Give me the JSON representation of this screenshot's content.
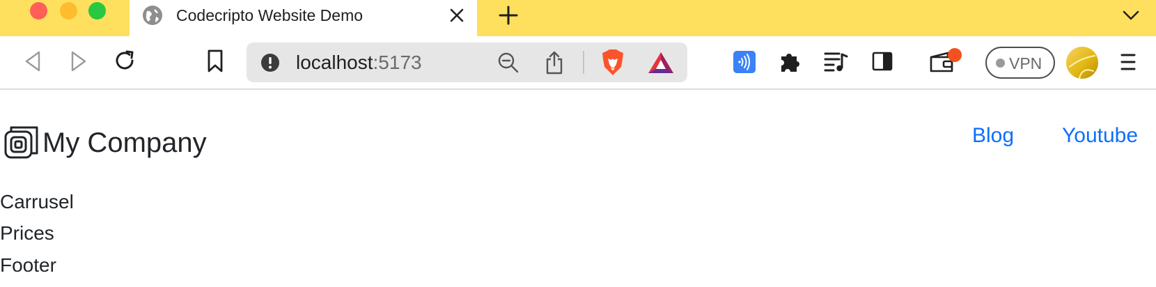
{
  "browser": {
    "tab": {
      "title": "Codecripto Website Demo"
    },
    "address": {
      "host": "localhost",
      "port": ":5173"
    },
    "vpn_label": "VPN",
    "wallet_badge_color": "#f4511e",
    "tabstrip_color": "#ffdf5e"
  },
  "page": {
    "brand": "My Company",
    "nav": {
      "blog": "Blog",
      "youtube": "Youtube"
    },
    "sections": [
      "Carrusel",
      "Prices",
      "Footer"
    ],
    "link_color": "#0d6efd"
  },
  "icons": {
    "tabstrip": [
      "globe-icon",
      "close-icon",
      "plus-icon",
      "chevron-down-icon"
    ],
    "toolbar": [
      "back-icon",
      "forward-icon",
      "reload-icon",
      "bookmark-icon",
      "info-icon",
      "zoom-out-icon",
      "share-icon",
      "brave-lion-icon",
      "brave-rewards-icon",
      "speedreader-icon",
      "puzzle-icon",
      "playlist-icon",
      "sidebar-icon",
      "wallet-icon",
      "avatar-icon",
      "menu-icon"
    ],
    "page": [
      "company-logo-icon"
    ]
  }
}
